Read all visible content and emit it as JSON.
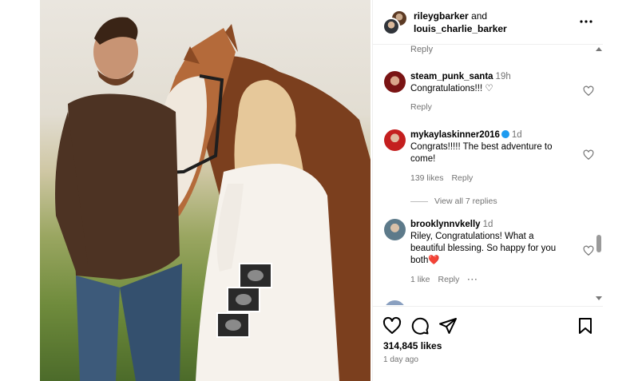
{
  "header": {
    "user1": "rileygbarker",
    "connector": "and",
    "user2": "louis_charlie_barker"
  },
  "comments": {
    "top_reply": "Reply",
    "items": [
      {
        "username": "steam_punk_santa",
        "time": "19h",
        "text": "Congratulations!!! ♡",
        "reply": "Reply"
      },
      {
        "username": "mykaylaskinner2016",
        "time": "1d",
        "text": "Congrats!!!!! The best adventure to come!",
        "likes": "139 likes",
        "reply": "Reply"
      },
      {
        "username": "brooklynnvkelly",
        "time": "1d",
        "text": "Riley, Congratulations! What a beautiful blessing. So happy for you both❤️",
        "likes": "1 like",
        "reply": "Reply"
      }
    ],
    "view_replies": "View all 7 replies"
  },
  "footer": {
    "likes": "314,845 likes",
    "time_ago": "1 day ago"
  },
  "icons": {
    "like": "heart-icon",
    "comment": "comment-icon",
    "share": "paper-plane-icon",
    "save": "bookmark-icon",
    "more": "more-options-icon",
    "next": "chevron-right-icon"
  }
}
